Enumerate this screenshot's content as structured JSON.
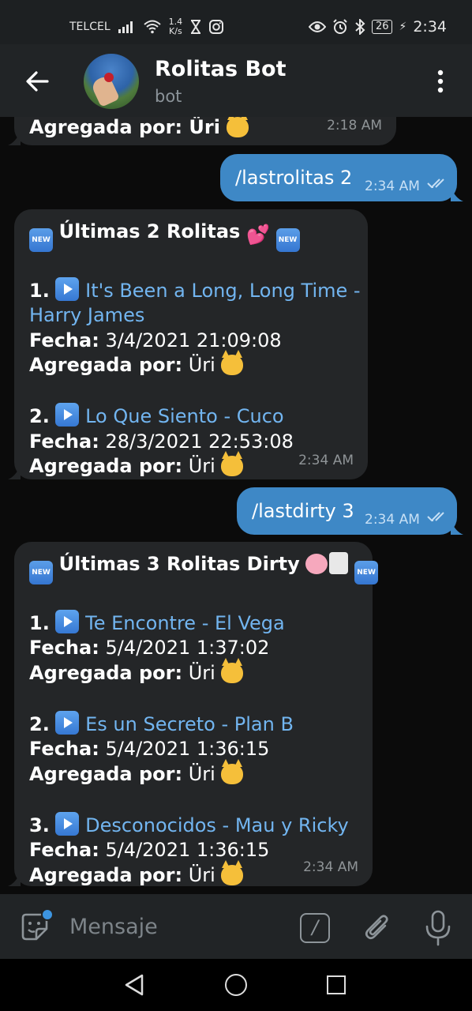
{
  "status_bar": {
    "carrier": "TELCEL",
    "speed_value": "1.4",
    "speed_unit": "K/s",
    "battery": "26",
    "time": "2:34"
  },
  "header": {
    "title": "Rolitas Bot",
    "subtitle": "bot"
  },
  "messages": {
    "prev": {
      "tail_text": "Agregada por: Üri",
      "time": "2:18 AM"
    },
    "cmd1": {
      "text": "/lastrolitas 2",
      "time": "2:34 AM"
    },
    "reply1": {
      "badge": "NEW",
      "heading": "Últimas 2 Rolitas",
      "items": [
        {
          "num": "1.",
          "song": "It's Been a Long, Long Time - Harry James",
          "song_l1": "It's Been a Long, Long Time -",
          "song_l2": "Harry James",
          "fecha_label": "Fecha:",
          "fecha": "3/4/2021 21:09:08",
          "by_label": "Agregada por:",
          "by": "Üri"
        },
        {
          "num": "2.",
          "song": "Lo Que Siento - Cuco",
          "fecha_label": "Fecha:",
          "fecha": "28/3/2021 22:53:08",
          "by_label": "Agregada por:",
          "by": "Üri"
        }
      ],
      "time": "2:34 AM"
    },
    "cmd2": {
      "text": "/lastdirty 3",
      "time": "2:34 AM"
    },
    "reply2": {
      "badge": "NEW",
      "heading": "Últimas 3 Rolitas Dirty",
      "items": [
        {
          "num": "1.",
          "song": "Te Encontre - El Vega",
          "fecha_label": "Fecha:",
          "fecha": "5/4/2021 1:37:02",
          "by_label": "Agregada por:",
          "by": "Üri"
        },
        {
          "num": "2.",
          "song": "Es un Secreto - Plan B",
          "fecha_label": "Fecha:",
          "fecha": "5/4/2021 1:36:15",
          "by_label": "Agregada por:",
          "by": "Üri"
        },
        {
          "num": "3.",
          "song": "Desconocidos - Mau y Ricky",
          "fecha_label": "Fecha:",
          "fecha": "5/4/2021 1:36:15",
          "by_label": "Agregada por:",
          "by": "Üri"
        }
      ],
      "time": "2:34 AM"
    }
  },
  "input": {
    "placeholder": "Mensaje",
    "command_glyph": "/"
  },
  "colors": {
    "accent": "#3e88c6",
    "link": "#72b5f0",
    "bubble_in": "#242628",
    "header_bg": "#212426"
  }
}
